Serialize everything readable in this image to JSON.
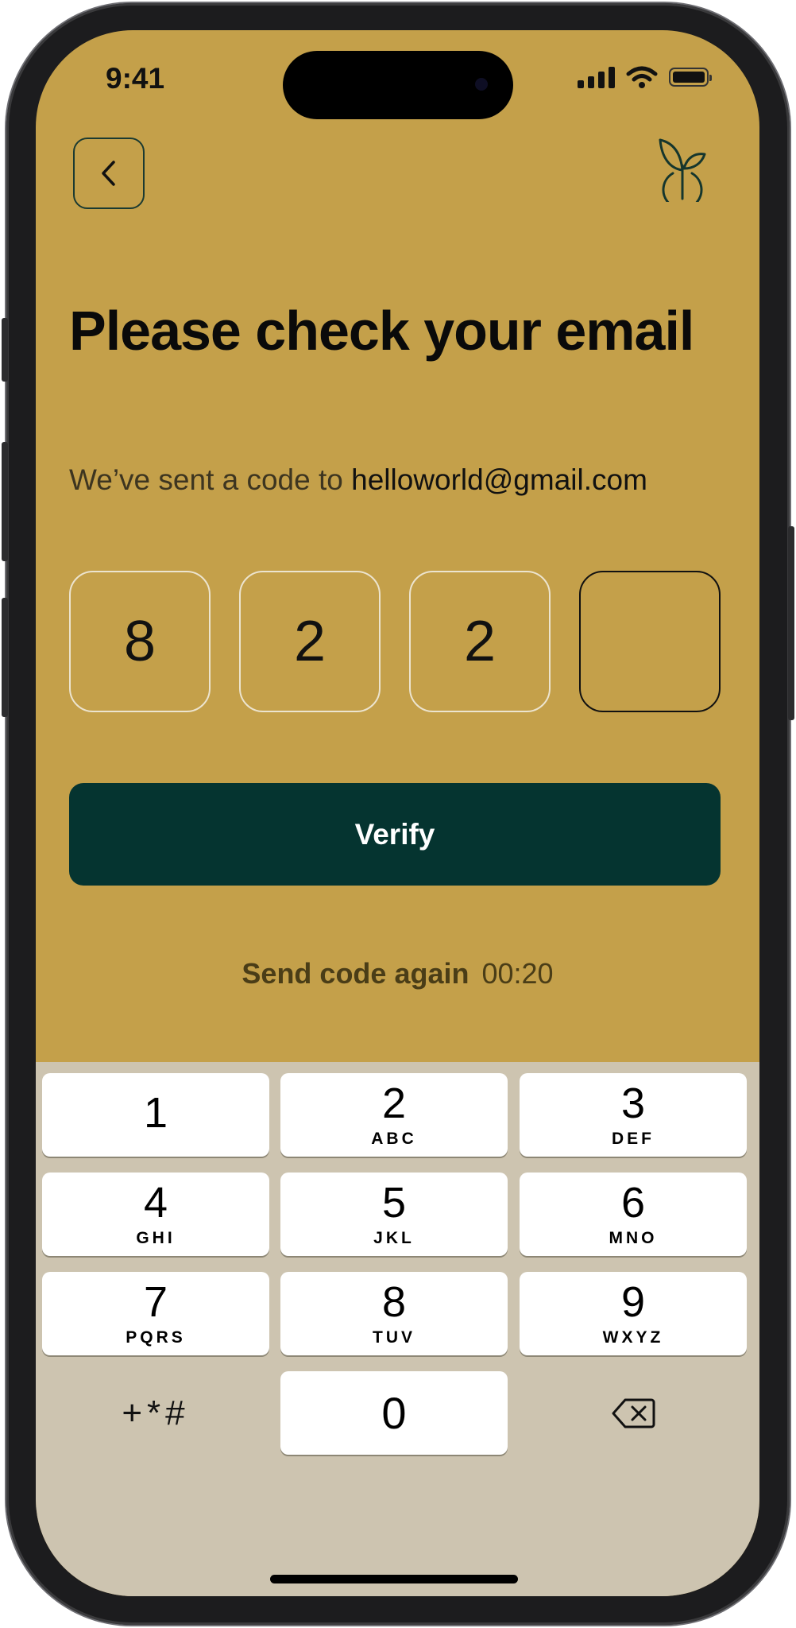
{
  "status_bar": {
    "time": "9:41"
  },
  "header": {
    "back_icon": "chevron-left-icon",
    "logo_icon": "sprout-logo-icon"
  },
  "content": {
    "title": "Please check your email",
    "subtitle_prefix": "We’ve sent a code to ",
    "email": "helloworld@gmail.com",
    "code_digits": [
      "8",
      "2",
      "2",
      ""
    ],
    "verify_label": "Verify",
    "resend_label": "Send code again",
    "resend_timer": "00:20"
  },
  "keypad": {
    "keys": [
      {
        "digit": "1",
        "letters": ""
      },
      {
        "digit": "2",
        "letters": "ABC"
      },
      {
        "digit": "3",
        "letters": "DEF"
      },
      {
        "digit": "4",
        "letters": "GHI"
      },
      {
        "digit": "5",
        "letters": "JKL"
      },
      {
        "digit": "6",
        "letters": "MNO"
      },
      {
        "digit": "7",
        "letters": "PQRS"
      },
      {
        "digit": "8",
        "letters": "TUV"
      },
      {
        "digit": "9",
        "letters": "WXYZ"
      }
    ],
    "symbols_label": "+*#",
    "zero": "0",
    "delete_icon": "backspace-icon"
  },
  "colors": {
    "background": "#c4a04a",
    "primary_button": "#053430",
    "keyboard_background": "#cdc4b0"
  }
}
